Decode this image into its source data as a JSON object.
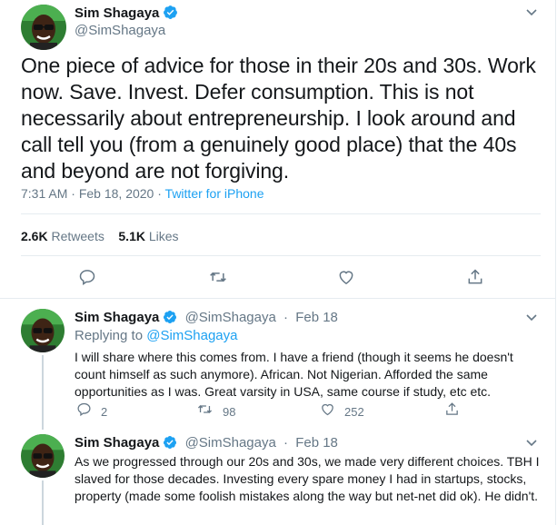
{
  "main_tweet": {
    "author_name": "Sim Shagaya",
    "author_handle": "@SimShagaya",
    "text": "One piece of advice for those in their 20s and 30s. Work now. Save. Invest. Defer consumption. This is not necessarily about entrepreneurship. I look around and call tell you (from a genuinely good place) that the 40s and beyond are not forgiving.",
    "time": "7:31 AM",
    "date_sep": " · ",
    "date": "Feb 18, 2020",
    "source_sep": " · ",
    "source": "Twitter for iPhone",
    "retweets_count": "2.6K",
    "retweets_label": "Retweets",
    "likes_count": "5.1K",
    "likes_label": "Likes"
  },
  "replies": [
    {
      "author_name": "Sim Shagaya",
      "author_handle": "@SimShagaya",
      "dot": "·",
      "date": "Feb 18",
      "replying_prefix": "Replying to ",
      "replying_to": "@SimShagaya",
      "text": "I will share where this comes from. I have a friend (though it seems he doesn't count himself as such anymore). African. Not Nigerian. Afforded the same opportunities as I was. Great varsity in USA, same course if study, etc etc.",
      "reply_count": "2",
      "retweet_count": "98",
      "like_count": "252"
    },
    {
      "author_name": "Sim Shagaya",
      "author_handle": "@SimShagaya",
      "dot": "·",
      "date": "Feb 18",
      "text": "As we progressed through our 20s and 30s, we made very different choices. TBH I slaved for those decades. Investing every spare money I had in startups, stocks, property (made some foolish mistakes along the way but net-net did ok). He didn't."
    }
  ],
  "colors": {
    "accent": "#1da1f2",
    "muted": "#657786",
    "border": "#e6ecf0"
  },
  "icons": [
    "verified-icon",
    "caret-down-icon",
    "reply-icon",
    "retweet-icon",
    "like-icon",
    "share-icon"
  ]
}
